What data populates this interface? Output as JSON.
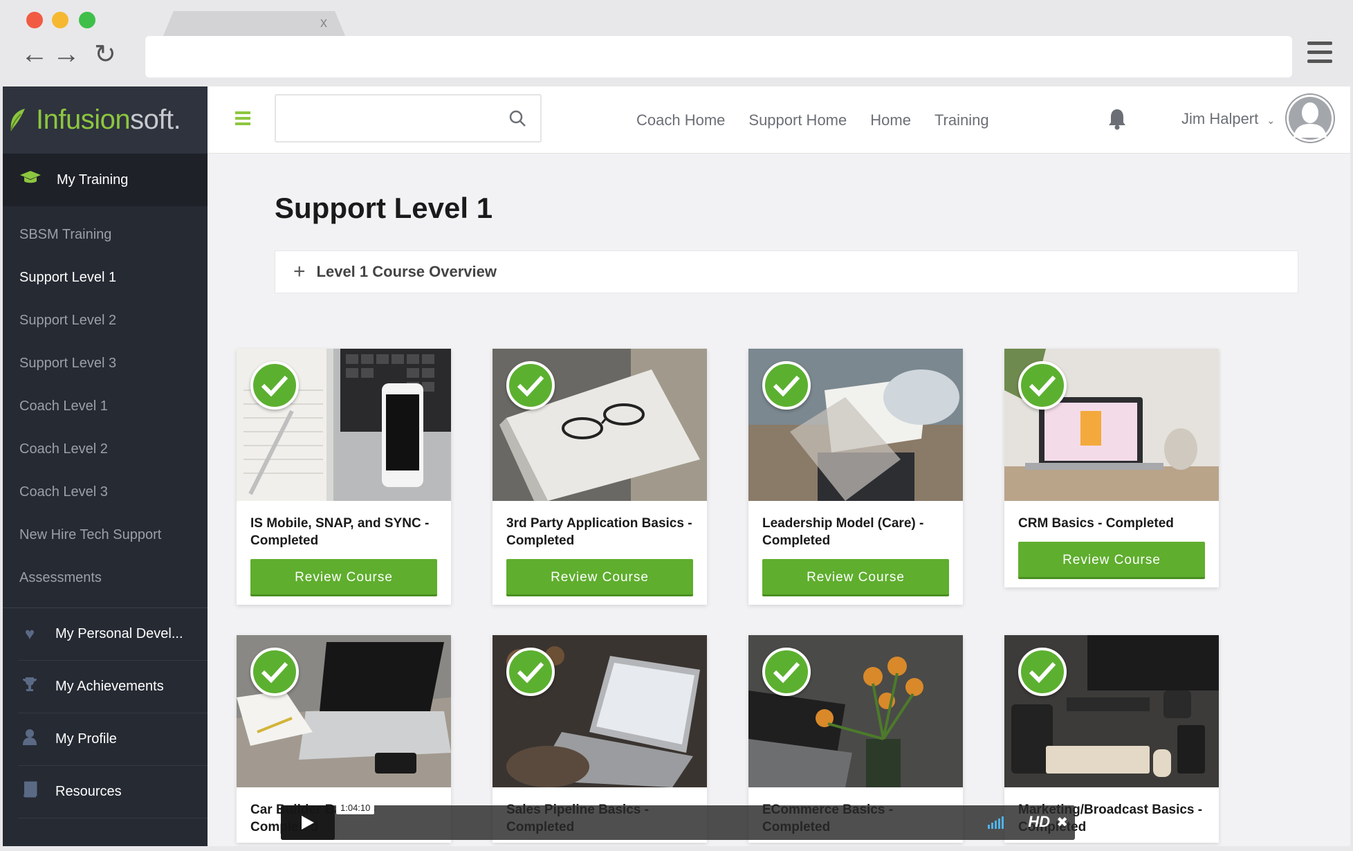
{
  "browser": {
    "tab_close": "x"
  },
  "brand": {
    "part1": "Infusion",
    "part2": "soft."
  },
  "sidebar": {
    "header": "My Training",
    "sub_items": [
      {
        "label": "SBSM Training",
        "active": false
      },
      {
        "label": "Support Level 1",
        "active": true
      },
      {
        "label": "Support Level 2",
        "active": false
      },
      {
        "label": "Support Level 3",
        "active": false
      },
      {
        "label": "Coach Level 1",
        "active": false
      },
      {
        "label": "Coach Level 2",
        "active": false
      },
      {
        "label": "Coach Level 3",
        "active": false
      },
      {
        "label": "New Hire Tech Support",
        "active": false
      },
      {
        "label": "Assessments",
        "active": false
      }
    ],
    "main_items": [
      {
        "label": "My Personal Devel...",
        "icon": "heart-icon"
      },
      {
        "label": "My Achievements",
        "icon": "trophy-icon"
      },
      {
        "label": "My Profile",
        "icon": "user-icon"
      },
      {
        "label": "Resources",
        "icon": "book-icon"
      }
    ]
  },
  "topbar": {
    "search_placeholder": "",
    "nav": [
      "Coach Home",
      "Support Home",
      "Home",
      "Training"
    ],
    "user_name": "Jim Halpert"
  },
  "main": {
    "title": "Support Level 1",
    "overview_label": "Level 1 Course Overview",
    "button_label": "Review Course",
    "courses": [
      {
        "title": "IS Mobile, SNAP, and SYNC - Completed",
        "theme": "#d8d8d6"
      },
      {
        "title": "3rd Party Application Basics - Completed",
        "theme": "#6a6864"
      },
      {
        "title": "Leadership Model (Care) - Completed",
        "theme": "#7b8890"
      },
      {
        "title": "CRM Basics - Completed",
        "theme": "#c9c3bb"
      },
      {
        "title": "Car Builder Basics - Completed",
        "theme": "#8a8885"
      },
      {
        "title": "Sales Pipeline Basics - Completed",
        "theme": "#3a3431"
      },
      {
        "title": "ECommerce Basics - Completed",
        "theme": "#4a4a48"
      },
      {
        "title": "Marketing/Broadcast Basics - Completed",
        "theme": "#3c3b39"
      }
    ]
  },
  "video": {
    "timecode": "1:04:10",
    "quality": "HD"
  },
  "colors": {
    "accent": "#8dc63f",
    "button": "#5fae2e",
    "sidebar": "#262a33"
  }
}
